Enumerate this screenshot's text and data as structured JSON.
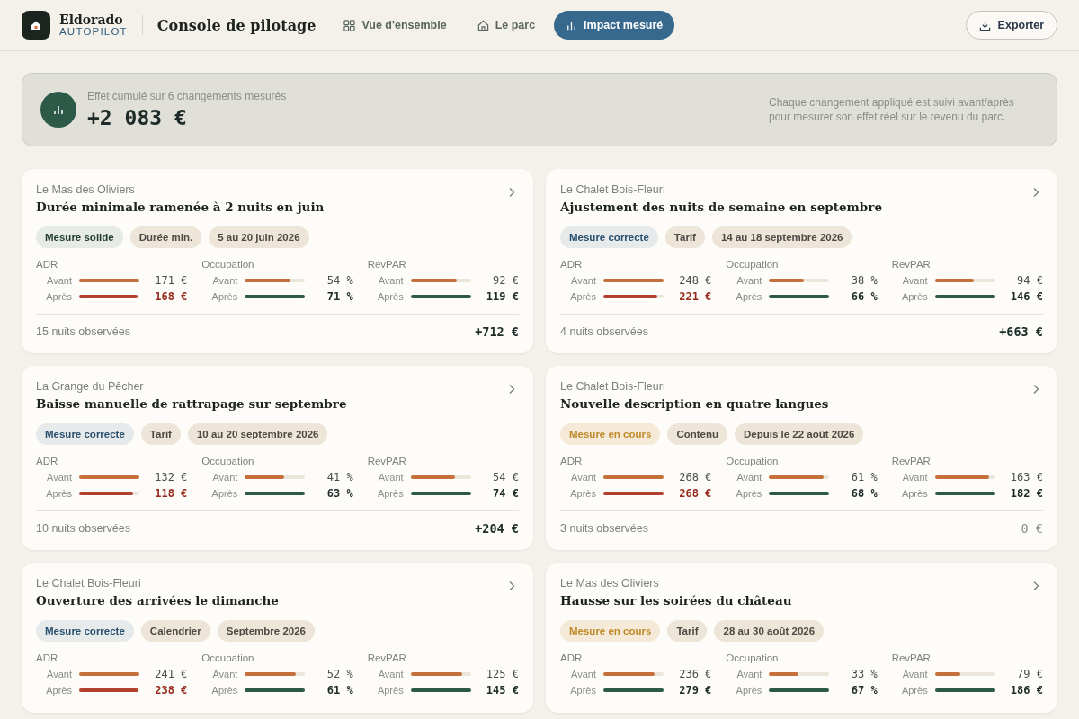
{
  "brand": {
    "name": "Eldorado",
    "sub": "AUTOPILOT"
  },
  "page_title": "Console de pilotage",
  "nav": [
    {
      "label": "Vue d'ensemble",
      "selected": false
    },
    {
      "label": "Le parc",
      "selected": false
    },
    {
      "label": "Impact mesuré",
      "selected": true
    }
  ],
  "export_button": "Exporter",
  "summary": {
    "caption": "Effet cumulé sur 6 changements mesurés",
    "total": "+2 083 €",
    "note": "Chaque changement appliqué est suivi avant/après pour mesurer son effet réel sur le revenu du parc."
  },
  "cards": [
    {
      "place": "Le Mas des Oliviers",
      "title": "Durée minimale ramenée à 2 nuits en juin",
      "tags": [
        {
          "label": "Mesure solide",
          "kind": "solid"
        },
        {
          "label": "Durée min.",
          "kind": "plain"
        },
        {
          "label": "5 au 20 juin 2026",
          "kind": "plain"
        }
      ],
      "metrics": [
        {
          "name": "ADR",
          "before": {
            "label": "Avant",
            "level": 1,
            "value": "171 €"
          },
          "after": {
            "label": "Après",
            "level": 0.97,
            "value": "168 €",
            "kind": "decrease"
          }
        },
        {
          "name": "Occupation",
          "before": {
            "label": "Avant",
            "level": 0.76,
            "value": "54 %"
          },
          "after": {
            "label": "Après",
            "level": 1,
            "value": "71 %",
            "kind": "increase"
          }
        },
        {
          "name": "RevPAR",
          "before": {
            "label": "Avant",
            "level": 0.77,
            "value": "92 €"
          },
          "after": {
            "label": "Après",
            "level": 1,
            "value": "119 €",
            "kind": "increase"
          }
        }
      ],
      "nights": "15 nuits observées",
      "result": {
        "value": "+712 €",
        "kind": "gain"
      }
    },
    {
      "place": "Le Chalet Bois-Fleuri",
      "title": "Ajustement des nuits de semaine en septembre",
      "tags": [
        {
          "label": "Mesure correcte",
          "kind": "correct"
        },
        {
          "label": "Tarif",
          "kind": "plain"
        },
        {
          "label": "14 au 18 septembre 2026",
          "kind": "plain"
        }
      ],
      "metrics": [
        {
          "name": "ADR",
          "before": {
            "label": "Avant",
            "level": 1,
            "value": "248 €"
          },
          "after": {
            "label": "Après",
            "level": 0.89,
            "value": "221 €",
            "kind": "decrease"
          }
        },
        {
          "name": "Occupation",
          "before": {
            "label": "Avant",
            "level": 0.58,
            "value": "38 %"
          },
          "after": {
            "label": "Après",
            "level": 1,
            "value": "66 %",
            "kind": "increase"
          }
        },
        {
          "name": "RevPAR",
          "before": {
            "label": "Avant",
            "level": 0.64,
            "value": "94 €"
          },
          "after": {
            "label": "Après",
            "level": 1,
            "value": "146 €",
            "kind": "increase"
          }
        }
      ],
      "nights": "4 nuits observées",
      "result": {
        "value": "+663 €",
        "kind": "gain"
      }
    },
    {
      "place": "La Grange du Pêcher",
      "title": "Baisse manuelle de rattrapage sur septembre",
      "tags": [
        {
          "label": "Mesure correcte",
          "kind": "correct"
        },
        {
          "label": "Tarif",
          "kind": "plain"
        },
        {
          "label": "10 au 20 septembre 2026",
          "kind": "plain"
        }
      ],
      "metrics": [
        {
          "name": "ADR",
          "before": {
            "label": "Avant",
            "level": 1,
            "value": "132 €"
          },
          "after": {
            "label": "Après",
            "level": 0.89,
            "value": "118 €",
            "kind": "decrease"
          }
        },
        {
          "name": "Occupation",
          "before": {
            "label": "Avant",
            "level": 0.65,
            "value": "41 %"
          },
          "after": {
            "label": "Après",
            "level": 1,
            "value": "63 %",
            "kind": "increase"
          }
        },
        {
          "name": "RevPAR",
          "before": {
            "label": "Avant",
            "level": 0.73,
            "value": "54 €"
          },
          "after": {
            "label": "Après",
            "level": 1,
            "value": "74 €",
            "kind": "increase"
          }
        }
      ],
      "nights": "10 nuits observées",
      "result": {
        "value": "+204 €",
        "kind": "gain"
      }
    },
    {
      "place": "Le Chalet Bois-Fleuri",
      "title": "Nouvelle description en quatre langues",
      "tags": [
        {
          "label": "Mesure en cours",
          "kind": "ongoing"
        },
        {
          "label": "Contenu",
          "kind": "plain"
        },
        {
          "label": "Depuis le 22 août 2026",
          "kind": "plain"
        }
      ],
      "metrics": [
        {
          "name": "ADR",
          "before": {
            "label": "Avant",
            "level": 1,
            "value": "268 €"
          },
          "after": {
            "label": "Après",
            "level": 1,
            "value": "268 €",
            "kind": "decrease"
          }
        },
        {
          "name": "Occupation",
          "before": {
            "label": "Avant",
            "level": 0.9,
            "value": "61 %"
          },
          "after": {
            "label": "Après",
            "level": 1,
            "value": "68 %",
            "kind": "increase"
          }
        },
        {
          "name": "RevPAR",
          "before": {
            "label": "Avant",
            "level": 0.9,
            "value": "163 €"
          },
          "after": {
            "label": "Après",
            "level": 1,
            "value": "182 €",
            "kind": "increase"
          }
        }
      ],
      "nights": "3 nuits observées",
      "result": {
        "value": "0 €",
        "kind": "neutral"
      }
    },
    {
      "place": "Le Chalet Bois-Fleuri",
      "title": "Ouverture des arrivées le dimanche",
      "tags": [
        {
          "label": "Mesure correcte",
          "kind": "correct"
        },
        {
          "label": "Calendrier",
          "kind": "plain"
        },
        {
          "label": "Septembre 2026",
          "kind": "plain"
        }
      ],
      "metrics": [
        {
          "name": "ADR",
          "before": {
            "label": "Avant",
            "level": 1,
            "value": "241 €"
          },
          "after": {
            "label": "Après",
            "level": 0.99,
            "value": "238 €",
            "kind": "decrease"
          }
        },
        {
          "name": "Occupation",
          "before": {
            "label": "Avant",
            "level": 0.85,
            "value": "52 %"
          },
          "after": {
            "label": "Après",
            "level": 1,
            "value": "61 %",
            "kind": "increase"
          }
        },
        {
          "name": "RevPAR",
          "before": {
            "label": "Avant",
            "level": 0.86,
            "value": "125 €"
          },
          "after": {
            "label": "Après",
            "level": 1,
            "value": "145 €",
            "kind": "increase"
          }
        }
      ]
    },
    {
      "place": "Le Mas des Oliviers",
      "title": "Hausse sur les soirées du château",
      "tags": [
        {
          "label": "Mesure en cours",
          "kind": "ongoing"
        },
        {
          "label": "Tarif",
          "kind": "plain"
        },
        {
          "label": "28 au 30 août 2026",
          "kind": "plain"
        }
      ],
      "metrics": [
        {
          "name": "ADR",
          "before": {
            "label": "Avant",
            "level": 0.85,
            "value": "236 €"
          },
          "after": {
            "label": "Après",
            "level": 1,
            "value": "279 €",
            "kind": "increase"
          }
        },
        {
          "name": "Occupation",
          "before": {
            "label": "Avant",
            "level": 0.49,
            "value": "33 %"
          },
          "after": {
            "label": "Après",
            "level": 1,
            "value": "67 %",
            "kind": "increase"
          }
        },
        {
          "name": "RevPAR",
          "before": {
            "label": "Avant",
            "level": 0.42,
            "value": "79 €"
          },
          "after": {
            "label": "Après",
            "level": 1,
            "value": "186 €",
            "kind": "increase"
          }
        }
      ]
    }
  ]
}
